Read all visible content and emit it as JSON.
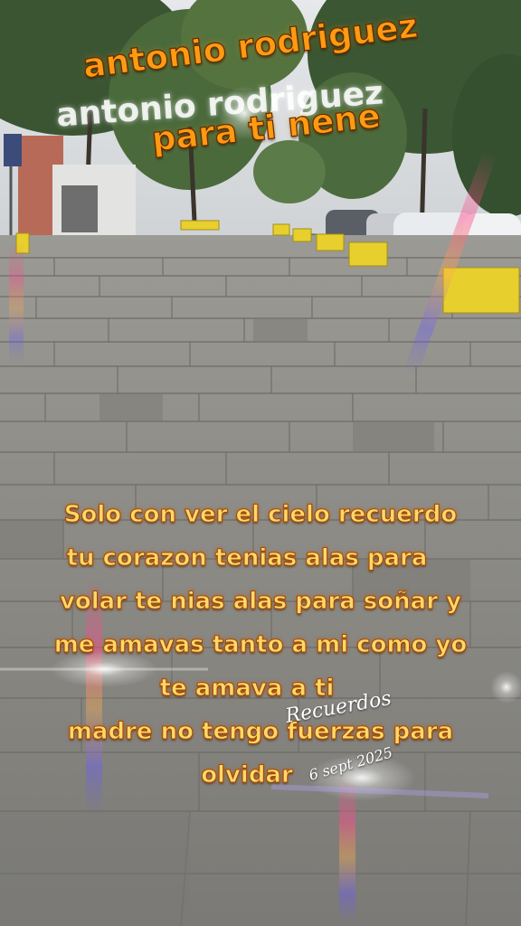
{
  "title": {
    "line1": "antonio rodriguez",
    "line2": "para ti nene",
    "echo": "antonio rodriguez",
    "color": "#ff9b12"
  },
  "poem": {
    "lines": [
      "Solo con ver el cielo recuerdo",
      "tu corazon tenias alas para",
      "volar te nias alas para soñar  y",
      "me amavas tanto a mi como yo",
      "te amava a ti",
      "madre no tengo fuerzas para",
      "olvidar"
    ],
    "color": "#ffd86a"
  },
  "signature": {
    "text": "Recuerdos",
    "date": "6 sept 2025"
  },
  "scene": {
    "description_icon": "street-sidewalk-photo"
  }
}
